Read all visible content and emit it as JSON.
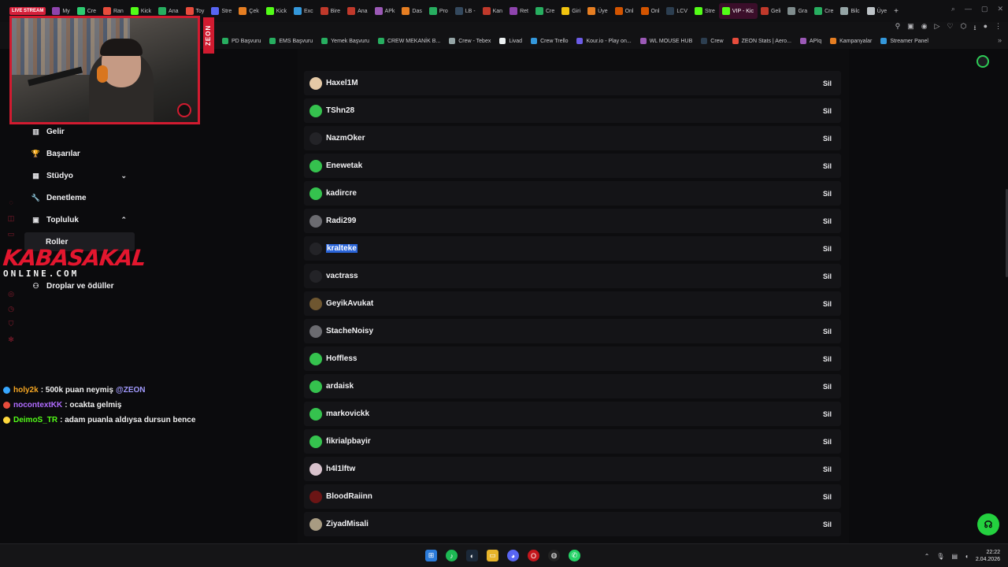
{
  "browser": {
    "live_badge": "LIVE STREAM",
    "tabs": [
      {
        "label": "My",
        "color": "#8e44ad"
      },
      {
        "label": "Cre",
        "color": "#2ecc71"
      },
      {
        "label": "Ran",
        "color": "#e74c3c"
      },
      {
        "label": "Kick",
        "color": "#53fc18"
      },
      {
        "label": "Ana",
        "color": "#27ae60"
      },
      {
        "label": "Toy",
        "color": "#e74c3c"
      },
      {
        "label": "Stre",
        "color": "#5865f2"
      },
      {
        "label": "Çek",
        "color": "#e67e22"
      },
      {
        "label": "Kick",
        "color": "#53fc18"
      },
      {
        "label": "Exc",
        "color": "#3498db"
      },
      {
        "label": "Bire",
        "color": "#c0392b"
      },
      {
        "label": "Ana",
        "color": "#c0392b"
      },
      {
        "label": "APk",
        "color": "#9b59b6"
      },
      {
        "label": "Das",
        "color": "#e67e22"
      },
      {
        "label": "Pro",
        "color": "#27ae60"
      },
      {
        "label": "LB -",
        "color": "#34495e"
      },
      {
        "label": "Kan",
        "color": "#c0392b"
      },
      {
        "label": "Ret",
        "color": "#8e44ad"
      },
      {
        "label": "Cre",
        "color": "#27ae60"
      },
      {
        "label": "Giri",
        "color": "#f1c40f"
      },
      {
        "label": "Üye",
        "color": "#e67e22"
      },
      {
        "label": "Onl",
        "color": "#d35400"
      },
      {
        "label": "Onl",
        "color": "#d35400"
      },
      {
        "label": "LCV",
        "color": "#2c3e50"
      },
      {
        "label": "Stre",
        "color": "#53fc18"
      },
      {
        "label": "VIP - Kic",
        "color": "#53fc18"
      },
      {
        "label": "Geli",
        "color": "#c0392b"
      },
      {
        "label": "Gra",
        "color": "#7f8c8d"
      },
      {
        "label": "Cre",
        "color": "#27ae60"
      },
      {
        "label": "Bilc",
        "color": "#95a5a6"
      },
      {
        "label": "Üye",
        "color": "#bdc3c7"
      }
    ],
    "active_tab_index": 25,
    "new_tab": "+",
    "bookmarks": [
      {
        "label": "PD Başvuru",
        "color": "#27ae60"
      },
      {
        "label": "EMS Başvuru",
        "color": "#27ae60"
      },
      {
        "label": "Yemek Başvuru",
        "color": "#27ae60"
      },
      {
        "label": "CREW MEKANİK B...",
        "color": "#27ae60"
      },
      {
        "label": "Crew - Tebex",
        "color": "#95a5a6"
      },
      {
        "label": "Livad",
        "color": "#ecf0f1"
      },
      {
        "label": "Crew Trello",
        "color": "#3498db"
      },
      {
        "label": "Kour.io - Play on...",
        "color": "#6c5ce7"
      },
      {
        "label": "WL MOUSE HUB",
        "color": "#9b59b6"
      },
      {
        "label": "Crew",
        "color": "#2c3e50"
      },
      {
        "label": "ZEON Stats | Aero...",
        "color": "#e74c3c"
      },
      {
        "label": "APIq",
        "color": "#9b59b6"
      },
      {
        "label": "Kampanyalar",
        "color": "#e67e22"
      },
      {
        "label": "Streamer Panel",
        "color": "#3498db"
      }
    ]
  },
  "webcam": {
    "side_banner": "ZEON"
  },
  "sidebar": {
    "items": [
      {
        "label": "Gelir",
        "icon": "bar-chart-icon",
        "glyph": "▥"
      },
      {
        "label": "Başarılar",
        "icon": "trophy-icon",
        "glyph": "🏆"
      },
      {
        "label": "Stüdyo",
        "icon": "studio-icon",
        "glyph": "▦",
        "chevron": "⌄"
      },
      {
        "label": "Denetleme",
        "icon": "wrench-icon",
        "glyph": "🔧"
      },
      {
        "label": "Topluluk",
        "icon": "community-icon",
        "glyph": "▣",
        "chevron": "⌃"
      }
    ],
    "sub_active": "Roller",
    "drops": {
      "label": "Droplar ve ödüller",
      "icon": "gift-icon",
      "glyph": "⚇"
    }
  },
  "overlay_brand": {
    "top": "KABASAKAL",
    "bottom": "ONLINE.COM"
  },
  "chat": [
    {
      "user": "holy2k",
      "user_color": "#f5a623",
      "message": ": 500k puan neymiş",
      "mention": "@ZEON"
    },
    {
      "user": "nocontextKK",
      "user_color": "#b06bff",
      "message": ": ocakta gelmiş",
      "mention": ""
    },
    {
      "user": "DeimoS_TR",
      "user_color": "#53fc18",
      "message": ": adam puanla aldıysa dursun bence",
      "mention": ""
    }
  ],
  "roles_list": {
    "delete_label": "Sil",
    "users": [
      {
        "name": "Haxel1M",
        "avatar": "av-beige"
      },
      {
        "name": "TShn28",
        "avatar": "av-green"
      },
      {
        "name": "NazmOker",
        "avatar": "av-dark"
      },
      {
        "name": "Enewetak",
        "avatar": "av-green"
      },
      {
        "name": "kadircre",
        "avatar": "av-green"
      },
      {
        "name": "Radi299",
        "avatar": "av-gray"
      },
      {
        "name": "kralteke",
        "avatar": "av-dark",
        "selected": true
      },
      {
        "name": "vactrass",
        "avatar": "av-dark"
      },
      {
        "name": "GeyikAvukat",
        "avatar": "av-brown"
      },
      {
        "name": "StacheNoisy",
        "avatar": "av-gray"
      },
      {
        "name": "Hoffless",
        "avatar": "av-green"
      },
      {
        "name": "ardaisk",
        "avatar": "av-green"
      },
      {
        "name": "markovickk",
        "avatar": "av-green"
      },
      {
        "name": "fikrialpbayir",
        "avatar": "av-green"
      },
      {
        "name": "h4l1lftw",
        "avatar": "av-pink"
      },
      {
        "name": "BloodRaiinn",
        "avatar": "av-red"
      },
      {
        "name": "ZiyadMisali",
        "avatar": "av-tan"
      }
    ]
  },
  "taskbar": {
    "time": "22:22",
    "date": "2.04.2026"
  }
}
